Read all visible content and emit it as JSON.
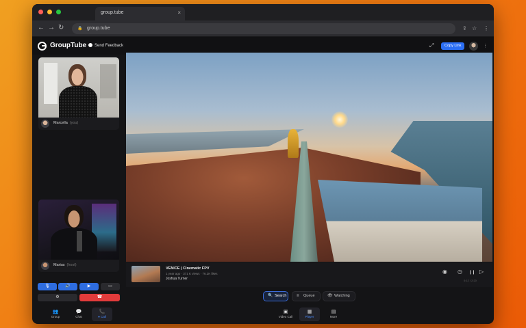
{
  "browser": {
    "tab_title": "group.tube",
    "tab_close": "×",
    "url": "group.tube",
    "nav": {
      "back": "←",
      "forward": "→",
      "reload": "↻",
      "lock": "🔒"
    },
    "right_icons": {
      "share": "⇪",
      "star": "☆",
      "menu": "⋮"
    },
    "traffic_colors": [
      "#ff5f57",
      "#febc2e",
      "#28c840"
    ]
  },
  "header": {
    "brand": "GroupTube",
    "feedback": "Send Feedback",
    "copy_link": "Copy Link",
    "expand_icon": "⤢",
    "more_icon": "⋮"
  },
  "participants": [
    {
      "name": "Marcella",
      "tag": "(you)"
    },
    {
      "name": "Marius",
      "tag": "(host)"
    }
  ],
  "controls": {
    "mic": "🎙",
    "speaker": "🔊",
    "camera": "▶",
    "screen": "▭",
    "settings": "⚙",
    "hangup": "☎"
  },
  "left_nav": [
    {
      "icon": "👥",
      "label": "Group",
      "badge": "1"
    },
    {
      "icon": "💬",
      "label": "Chat"
    },
    {
      "icon": "📞",
      "label": "● Call",
      "active": true
    }
  ],
  "right_nav": [
    {
      "icon": "▣",
      "label": "Video Call"
    },
    {
      "icon": "▦",
      "label": "Player",
      "active": true
    },
    {
      "icon": "▤",
      "label": "More"
    }
  ],
  "video": {
    "title": "VENICE | Cinematic FPV",
    "meta": "1 year ago · 371 K views · 76.2K likes",
    "channel": "Joshua Turner",
    "time": "0:12 / 2:20",
    "icons": {
      "eye": "◉",
      "timer": "◷",
      "pause": "❙❙",
      "next": "▷"
    }
  },
  "tabs": [
    {
      "icon": "🔍",
      "label": "Search",
      "active": true
    },
    {
      "icon": "≡",
      "label": "Queue",
      "badge": "·"
    },
    {
      "icon": "👁",
      "label": "Watching"
    }
  ],
  "colors": {
    "accent": "#2b6ef3",
    "hangup": "#e23b3b",
    "bg_window": "#141416"
  }
}
